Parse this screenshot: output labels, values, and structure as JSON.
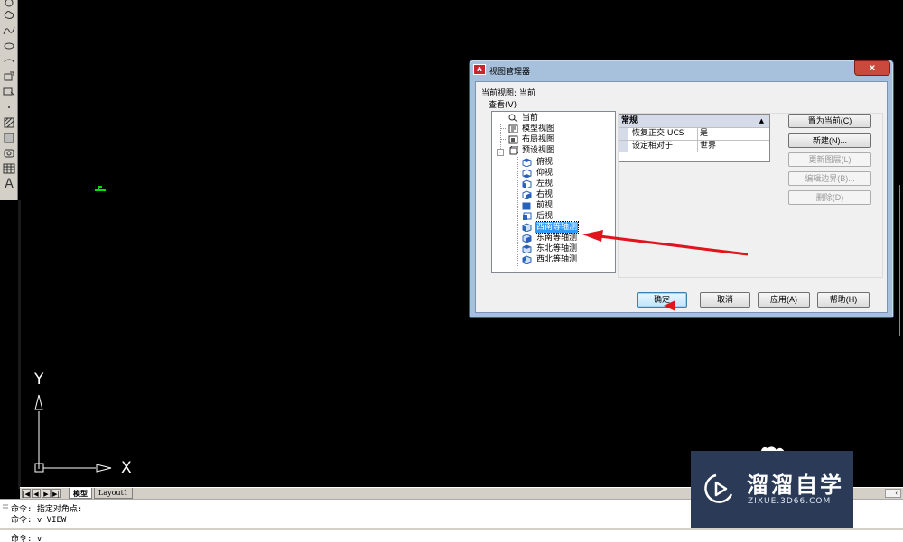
{
  "left_toolbar": {
    "icons": [
      "rotate-icon",
      "revision-cloud-icon",
      "spline-icon",
      "ellipse-icon",
      "ellipse-arc-icon",
      "insert-block-icon",
      "make-block-icon",
      "point-icon",
      "hatch-icon",
      "gradient-icon",
      "region-icon",
      "table-icon",
      "multiline-text-icon"
    ],
    "text_tool_glyph": "A"
  },
  "ucs": {
    "y_label": "Y",
    "x_label": "X"
  },
  "layout_tabs": {
    "nav": [
      "|◀",
      "◀",
      "▶",
      "▶|"
    ],
    "tabs": [
      "模型",
      "Layout1"
    ]
  },
  "command_area": {
    "lines": [
      "命令: 指定对角点:",
      "命令: v VIEW",
      "命令: v"
    ]
  },
  "watermark": {
    "title": "溜溜自学",
    "subtitle": "ZIXUE.3D66.COM"
  },
  "dialog": {
    "title": "视图管理器",
    "close_glyph": "x",
    "current_view": "当前视图: 当前",
    "view_group": "查看(V)",
    "tree": {
      "items": [
        {
          "label": "当前",
          "icon": "magnifier-icon",
          "level": 0
        },
        {
          "label": "模型视图",
          "icon": "model-view-icon",
          "level": 0
        },
        {
          "label": "布局视图",
          "icon": "layout-view-icon",
          "level": 0
        },
        {
          "label": "预设视图",
          "icon": "preset-view-icon",
          "level": 0,
          "expanded": true
        },
        {
          "label": "俯视",
          "icon": "cube-top-icon",
          "level": 1
        },
        {
          "label": "仰视",
          "icon": "cube-bottom-icon",
          "level": 1
        },
        {
          "label": "左视",
          "icon": "cube-left-icon",
          "level": 1
        },
        {
          "label": "右视",
          "icon": "cube-right-icon",
          "level": 1
        },
        {
          "label": "前视",
          "icon": "cube-front-icon",
          "level": 1
        },
        {
          "label": "后视",
          "icon": "cube-back-icon",
          "level": 1
        },
        {
          "label": "西南等轴测",
          "icon": "iso-sw-icon",
          "level": 1,
          "selected": true
        },
        {
          "label": "东南等轴测",
          "icon": "iso-se-icon",
          "level": 1
        },
        {
          "label": "东北等轴测",
          "icon": "iso-ne-icon",
          "level": 1
        },
        {
          "label": "西北等轴测",
          "icon": "iso-nw-icon",
          "level": 1
        }
      ]
    },
    "properties": {
      "section": "常规",
      "rows": [
        {
          "name": "恢复正交 UCS",
          "value": "是"
        },
        {
          "name": "设定相对于",
          "value": "世界"
        }
      ]
    },
    "side_buttons": [
      {
        "label": "置为当前(C)",
        "enabled": true
      },
      {
        "label": "新建(N)...",
        "enabled": true
      },
      {
        "label": "更新图层(L)",
        "enabled": false
      },
      {
        "label": "编辑边界(B)...",
        "enabled": false
      },
      {
        "label": "删除(D)",
        "enabled": false
      }
    ],
    "bottom_buttons": {
      "ok": "确定",
      "cancel": "取消",
      "apply": "应用(A)",
      "help": "帮助(H)"
    }
  },
  "colors": {
    "canvas": "#000000",
    "annotation_arrow": "#e0141c",
    "selection": "#3399ff",
    "ucs_marker": "#00e000",
    "watermark_bg": "#2b3a57"
  }
}
